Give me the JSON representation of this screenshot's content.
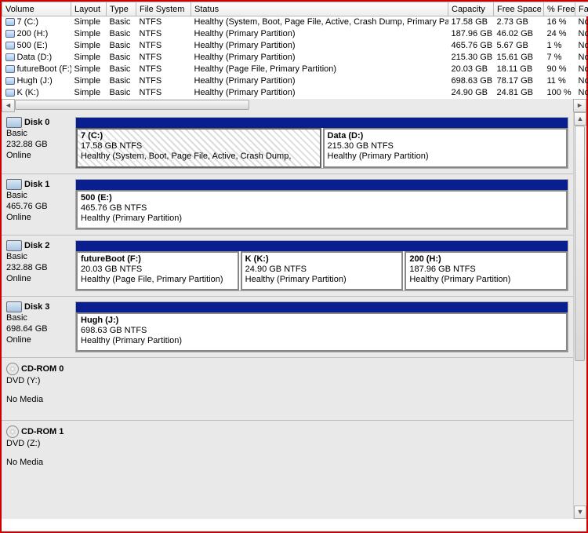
{
  "columns": {
    "volume": "Volume",
    "layout": "Layout",
    "type": "Type",
    "fs": "File System",
    "status": "Status",
    "capacity": "Capacity",
    "free": "Free Space",
    "pct": "% Free",
    "fault": "Fault"
  },
  "volumes": [
    {
      "name": "7 (C:)",
      "layout": "Simple",
      "type": "Basic",
      "fs": "NTFS",
      "status": "Healthy (System, Boot, Page File, Active, Crash Dump, Primary Partition)",
      "capacity": "17.58 GB",
      "free": "2.73 GB",
      "pct": "16 %",
      "fault": "No"
    },
    {
      "name": "200 (H:)",
      "layout": "Simple",
      "type": "Basic",
      "fs": "NTFS",
      "status": "Healthy (Primary Partition)",
      "capacity": "187.96 GB",
      "free": "46.02 GB",
      "pct": "24 %",
      "fault": "No"
    },
    {
      "name": "500 (E:)",
      "layout": "Simple",
      "type": "Basic",
      "fs": "NTFS",
      "status": "Healthy (Primary Partition)",
      "capacity": "465.76 GB",
      "free": "5.67 GB",
      "pct": "1 %",
      "fault": "No"
    },
    {
      "name": "Data (D:)",
      "layout": "Simple",
      "type": "Basic",
      "fs": "NTFS",
      "status": "Healthy (Primary Partition)",
      "capacity": "215.30 GB",
      "free": "15.61 GB",
      "pct": "7 %",
      "fault": "No"
    },
    {
      "name": "futureBoot (F:)",
      "layout": "Simple",
      "type": "Basic",
      "fs": "NTFS",
      "status": "Healthy (Page File, Primary Partition)",
      "capacity": "20.03 GB",
      "free": "18.11 GB",
      "pct": "90 %",
      "fault": "No"
    },
    {
      "name": "Hugh (J:)",
      "layout": "Simple",
      "type": "Basic",
      "fs": "NTFS",
      "status": "Healthy (Primary Partition)",
      "capacity": "698.63 GB",
      "free": "78.17 GB",
      "pct": "11 %",
      "fault": "No"
    },
    {
      "name": "K (K:)",
      "layout": "Simple",
      "type": "Basic",
      "fs": "NTFS",
      "status": "Healthy (Primary Partition)",
      "capacity": "24.90 GB",
      "free": "24.81 GB",
      "pct": "100 %",
      "fault": "No"
    }
  ],
  "disks": [
    {
      "id": "Disk 0",
      "kind": "hd",
      "type": "Basic",
      "size": "232.88 GB",
      "state": "Online",
      "parts": [
        {
          "name": "7  (C:)",
          "sub": "17.58 GB NTFS",
          "status": "Healthy (System, Boot, Page File, Active, Crash Dump,",
          "selected": true
        },
        {
          "name": "Data  (D:)",
          "sub": "215.30 GB NTFS",
          "status": "Healthy (Primary Partition)"
        }
      ]
    },
    {
      "id": "Disk 1",
      "kind": "hd",
      "type": "Basic",
      "size": "465.76 GB",
      "state": "Online",
      "parts": [
        {
          "name": "500  (E:)",
          "sub": "465.76 GB NTFS",
          "status": "Healthy (Primary Partition)"
        }
      ]
    },
    {
      "id": "Disk 2",
      "kind": "hd",
      "type": "Basic",
      "size": "232.88 GB",
      "state": "Online",
      "parts": [
        {
          "name": "futureBoot  (F:)",
          "sub": "20.03 GB NTFS",
          "status": "Healthy (Page File, Primary Partition)"
        },
        {
          "name": "K  (K:)",
          "sub": "24.90 GB NTFS",
          "status": "Healthy (Primary Partition)"
        },
        {
          "name": "200  (H:)",
          "sub": "187.96 GB NTFS",
          "status": "Healthy (Primary Partition)"
        }
      ]
    },
    {
      "id": "Disk 3",
      "kind": "hd",
      "type": "Basic",
      "size": "698.64 GB",
      "state": "Online",
      "parts": [
        {
          "name": "Hugh  (J:)",
          "sub": "698.63 GB NTFS",
          "status": "Healthy (Primary Partition)"
        }
      ]
    },
    {
      "id": "CD-ROM 0",
      "kind": "cd",
      "type": "DVD (Y:)",
      "size": "",
      "state": "No Media",
      "parts": []
    },
    {
      "id": "CD-ROM 1",
      "kind": "cd",
      "type": "DVD (Z:)",
      "size": "",
      "state": "No Media",
      "parts": []
    }
  ]
}
